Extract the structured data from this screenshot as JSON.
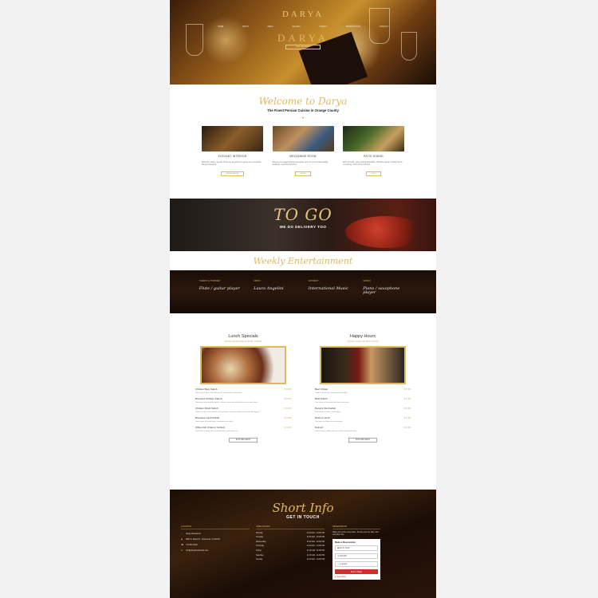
{
  "hero": {
    "logo": "DARYA",
    "nav": [
      "Home",
      "About",
      "Menu",
      "Gallery",
      "Events",
      "Reservations",
      "Contact"
    ],
    "big_text": "DARYA",
    "button": "Explore Menu"
  },
  "welcome": {
    "title": "Welcome to Darya",
    "subtitle": "The Finest Persian Cuisine in Orange County",
    "ornament": "~ ❦ ~",
    "rooms": [
      {
        "name": "Elegant Interior",
        "text": "Romantic, classy, special. These are all words our guests use to describe Darya's ambience.",
        "button": "Reservation"
      },
      {
        "name": "Mezzanine Room",
        "text": "Reserve our elegant private mezzanine room for your private holiday, weddings, corporate functions.",
        "button": "Book"
      },
      {
        "name": "Patio Dining",
        "text": "Don't just wait - take a dining destination. Whether casual, hosting friends or relaxing - fit for dinner al fresco.",
        "button": "Visit"
      }
    ]
  },
  "togo": {
    "title": "TO GO",
    "subtitle": "WE DO DELIVERY TOO"
  },
  "weekly": {
    "title": "Weekly Entertainment",
    "items": [
      {
        "day": "Tuesday & Thursday",
        "act": "Flute / guitar player"
      },
      {
        "day": "Friday",
        "act": "Laura Angelini"
      },
      {
        "day": "Saturday",
        "act": "International Music"
      },
      {
        "day": "Sunday",
        "act": "Piano / saxophone player"
      }
    ]
  },
  "lunch": {
    "title": "Lunch Specials",
    "subtitle": "Monday through Friday 11:30 AM - 3:00 PM",
    "items": [
      {
        "name": "Chicken Barg Kabob",
        "price": "$ 8.95",
        "desc": "Lean, juicy cubes of chicken breast, barbequed to perfection"
      },
      {
        "name": "Boneless Chicken Kabob",
        "price": "$ 8.95",
        "desc": "Deliciously marinated boneless chicken skewered and grilled over an open flame"
      },
      {
        "name": "Chicken Shish Kabob",
        "price": "$ 8.95",
        "desc": "Tender chunks of marinated chicken breast, skewered with onions and bell peppers"
      },
      {
        "name": "Boneless Lamb Kabob",
        "price": "$ 9.95",
        "desc": "Lean cubes of tender lamb, marinated and grilled"
      },
      {
        "name": "White Fish (Fried or Grilled)",
        "price": "$ 9.95",
        "desc": "Fresh fillet of white fish, seasoned and served with rice"
      }
    ],
    "button": "Explore Menu"
  },
  "happy": {
    "title": "Happy Hours",
    "subtitle": "Monday - Friday 4:00 PM to 7:00 PM",
    "items": [
      {
        "name": "Beef Chislet",
        "price": "$ 5.95",
        "desc": "Tender cuts of beef, marinated and grilled"
      },
      {
        "name": "Beef Kabob",
        "price": "$ 5.95",
        "desc": "Two skewers of ground beef with seasoning"
      },
      {
        "name": "Darya's Filet Kabob",
        "price": "$ 6.95",
        "desc": "Filet mignon chunks, charbroiled"
      },
      {
        "name": "Rack of Lamb",
        "price": "$ 6.95",
        "desc": "Two pieces of lamb rack, marinated"
      },
      {
        "name": "Dolmeh",
        "price": "$ 4.95",
        "desc": "Grape leaves stuffed with rice, herbs and ground beef"
      }
    ],
    "button": "Explore Menu"
  },
  "info": {
    "title": "Short Info",
    "subtitle": "GET IN TOUCH",
    "location_head": "Location",
    "location": [
      {
        "icon": "building-icon",
        "text": "Darya Restaurant"
      },
      {
        "icon": "map-pin-icon",
        "text": "3800 S. Plaza Dr., Santa Ana, CA 92704"
      },
      {
        "icon": "phone-icon",
        "text": "714.557.6600"
      },
      {
        "icon": "mail-icon",
        "text": "info@daryarestaurant.com"
      }
    ],
    "hours_head": "Open Hours",
    "hours": [
      {
        "day": "Monday",
        "time": "11:30 AM - 10:00 PM"
      },
      {
        "day": "Tuesday",
        "time": "11:30 AM - 10:00 PM"
      },
      {
        "day": "Wednesday",
        "time": "11:30 AM - 10:00 PM"
      },
      {
        "day": "Thursday",
        "time": "11:30 AM - 10:00 PM"
      },
      {
        "day": "Friday",
        "time": "11:30 AM - 11:00 PM"
      },
      {
        "day": "Saturday",
        "time": "11:30 AM - 11:00 PM"
      },
      {
        "day": "Sunday",
        "time": "11:30 AM - 10:00 PM"
      }
    ],
    "resv_head": "Reservation",
    "resv_text": "Make your online reservation. Simply enter the date, time and party size.",
    "card_title": "Make a Reservation",
    "date": "Apr 5, 2016",
    "time": "6:00 PM",
    "party": "2 people",
    "find_button": "Find a Table",
    "opentable": "OpenTable"
  },
  "colors": {
    "gold": "#e0b860",
    "red": "#d0302c"
  }
}
